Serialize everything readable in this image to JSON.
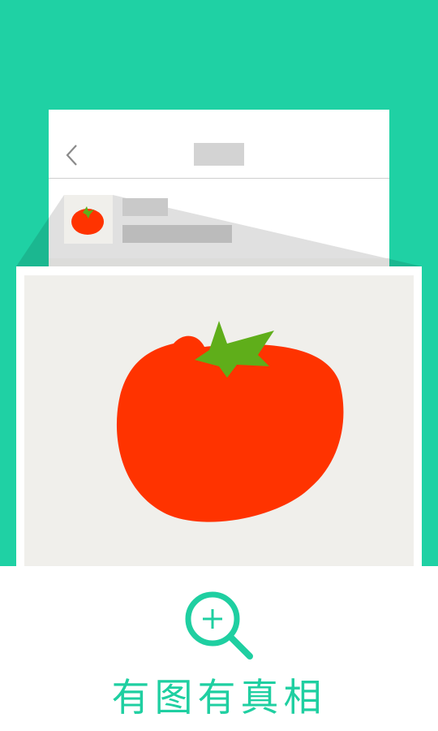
{
  "colors": {
    "background_teal": "#1fd1a4",
    "tomato_red": "#ff3300",
    "leaf_green": "#5fae1a",
    "accent": "#1fcfa1"
  },
  "icons": {
    "back": "chevron-left-icon",
    "zoom": "magnifier-plus-icon"
  },
  "caption": {
    "text": "有图有真相"
  }
}
